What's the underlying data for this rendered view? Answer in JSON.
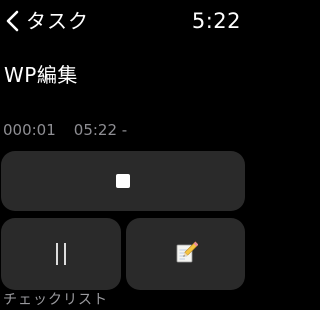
{
  "status_bar": {
    "back_label": "タスク",
    "time": "5:22"
  },
  "task": {
    "title": "WP編集",
    "elapsed": "000:01",
    "range": "05:22 -"
  },
  "controls": {
    "stop_icon": "stop-icon",
    "pause_icon": "pause-icon",
    "edit_icon": "memo-pencil-icon"
  },
  "checklist": {
    "header": "チェックリスト"
  },
  "colors": {
    "background": "#000000",
    "button": "#2a2a2a",
    "secondary_text": "#8e8e93"
  }
}
